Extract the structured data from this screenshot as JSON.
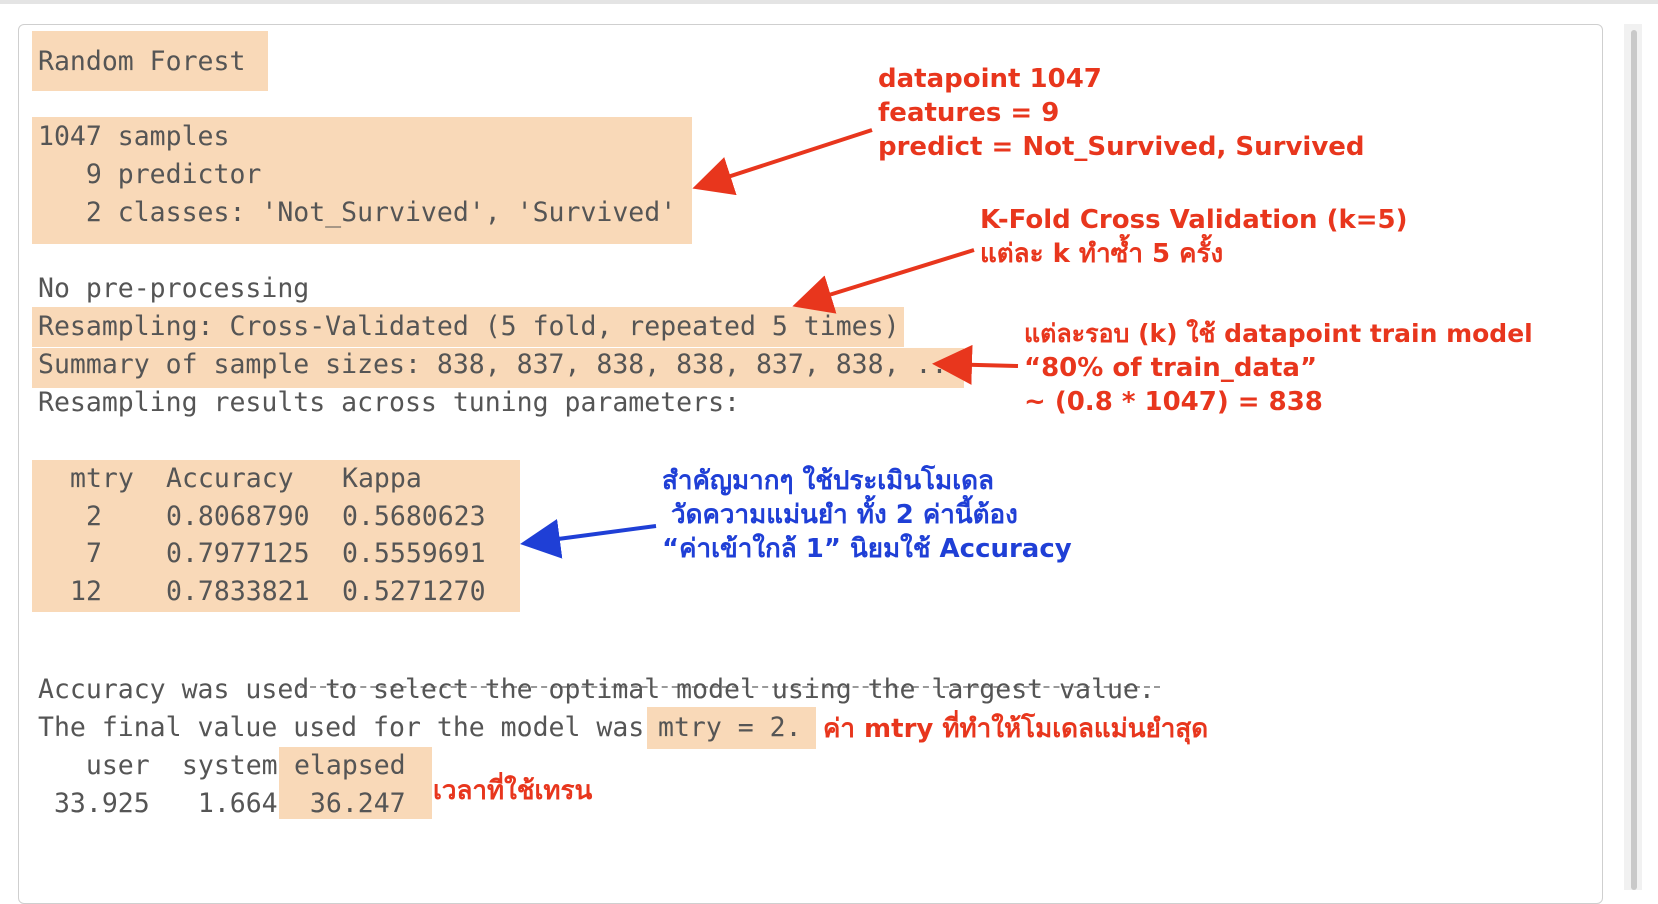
{
  "console": {
    "title": "Random Forest",
    "samples_line": "1047 samples",
    "predictor_line": "   9 predictor",
    "classes_line": "   2 classes: 'Not_Survived', 'Survived'",
    "preprocessing_line": "No pre-processing",
    "resampling_line": "Resampling: Cross-Validated (5 fold, repeated 5 times)",
    "summary_line": "Summary of sample sizes: 838, 837, 838, 838, 837, 838, ...",
    "results_header": "Resampling results across tuning parameters:",
    "table": {
      "columns": [
        "mtry",
        "Accuracy",
        "Kappa"
      ],
      "rows": [
        [
          "2",
          "0.8068790",
          "0.5680623"
        ],
        [
          "7",
          "0.7977125",
          "0.5559691"
        ],
        [
          "12",
          "0.7833821",
          "0.5271270"
        ]
      ]
    },
    "selection_line": "Accuracy was used to select the optimal model using the largest value.",
    "final_value_prefix": "The final value used for the model was ",
    "final_value": "mtry = 2.",
    "timing_header_user": "   user",
    "timing_header_system": "  system",
    "timing_header_elapsed": " elapsed",
    "timing_user": " 33.925",
    "timing_system": "   1.664",
    "timing_elapsed": "  36.247"
  },
  "annotations": {
    "dataset": {
      "line1": "datapoint 1047",
      "line2": "features = 9",
      "line3": "predict = Not_Survived, Survived"
    },
    "kfold": {
      "line1": "K-Fold Cross Validation (k=5)",
      "line2": "แต่ละ k ทำซ้ำ 5 ครั้ง"
    },
    "train_size": {
      "line1": "แต่ละรอบ (k) ใช้ datapoint train model",
      "line2": "“80% of train_data”",
      "line3": "~ (0.8 * 1047) = 838"
    },
    "metrics": {
      "line1": "สำคัญมากๆ ใช้ประเมินโมเดล",
      "line2": " วัดความแม่นยำ ทั้ง 2 ค่านี้ต้อง",
      "line3": "“ค่าเข้าใกล้ 1” นิยมใช้ Accuracy"
    },
    "mtry_note": "ค่า mtry ที่ทำให้โมเดลแม่นยำสุด",
    "time_note": "เวลาที่ใช้เทรน"
  },
  "colors": {
    "highlight": "#f9d9b8",
    "annotation_red": "#e8361d",
    "annotation_blue": "#1f3fd6",
    "console_text": "#555555"
  }
}
